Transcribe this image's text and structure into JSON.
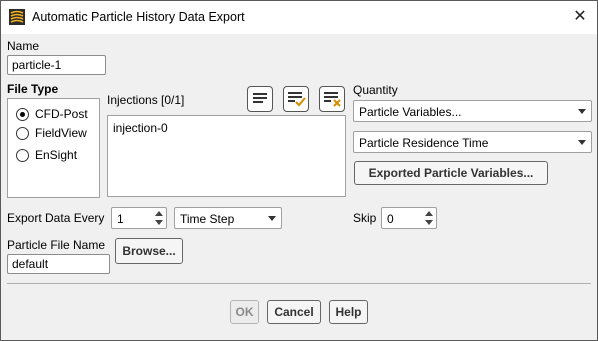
{
  "window": {
    "title": "Automatic Particle History Data Export",
    "close_glyph": "✕"
  },
  "name": {
    "label": "Name",
    "value": "particle-1"
  },
  "file_type": {
    "label": "File Type",
    "options": [
      {
        "label": "CFD-Post",
        "checked": true
      },
      {
        "label": "FieldView",
        "checked": false
      },
      {
        "label": "EnSight",
        "checked": false
      }
    ]
  },
  "injections": {
    "label": "Injections  [0/1]",
    "items": [
      "injection-0"
    ],
    "icons": [
      "list-icon",
      "select-all-icon",
      "deselect-all-icon"
    ]
  },
  "quantity": {
    "label": "Quantity",
    "category": "Particle Variables...",
    "variable": "Particle Residence Time",
    "exported_button": "Exported Particle Variables..."
  },
  "export_every": {
    "label": "Export Data Every",
    "value": "1",
    "unit": "Time Step"
  },
  "skip": {
    "label": "Skip",
    "value": "0"
  },
  "particle_file": {
    "label": "Particle File Name",
    "value": "default",
    "browse": "Browse..."
  },
  "buttons": {
    "ok": "OK",
    "cancel": "Cancel",
    "help": "Help"
  },
  "colors": {
    "accent_orange": "#e8a317",
    "check_orange": "#d98c00"
  }
}
